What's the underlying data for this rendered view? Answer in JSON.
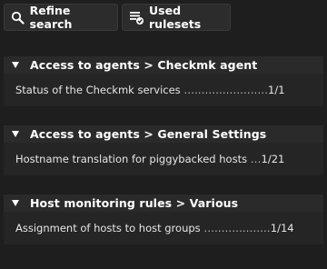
{
  "toolbar": {
    "refine_label": "Refine search",
    "refine_icon": "search-icon",
    "rulesets_label": "Used rulesets",
    "rulesets_icon": "rulesets-check-icon"
  },
  "sections": [
    {
      "title": "Access to agents > Checkmk agent",
      "rule": "Status of the Checkmk services",
      "dots": " ........................",
      "count": "1/1"
    },
    {
      "title": "Access to agents > General Settings",
      "rule": "Hostname translation for piggybacked hosts",
      "dots": " ...",
      "count": "1/21"
    },
    {
      "title": "Host monitoring rules > Various",
      "rule": "Assignment of hosts to host groups",
      "dots": " ...................",
      "count": "1/14"
    }
  ],
  "colors": {
    "background": "#1e1e1e",
    "header": "#2a2a2a",
    "row": "#252525",
    "text": "#e6e6e6"
  }
}
